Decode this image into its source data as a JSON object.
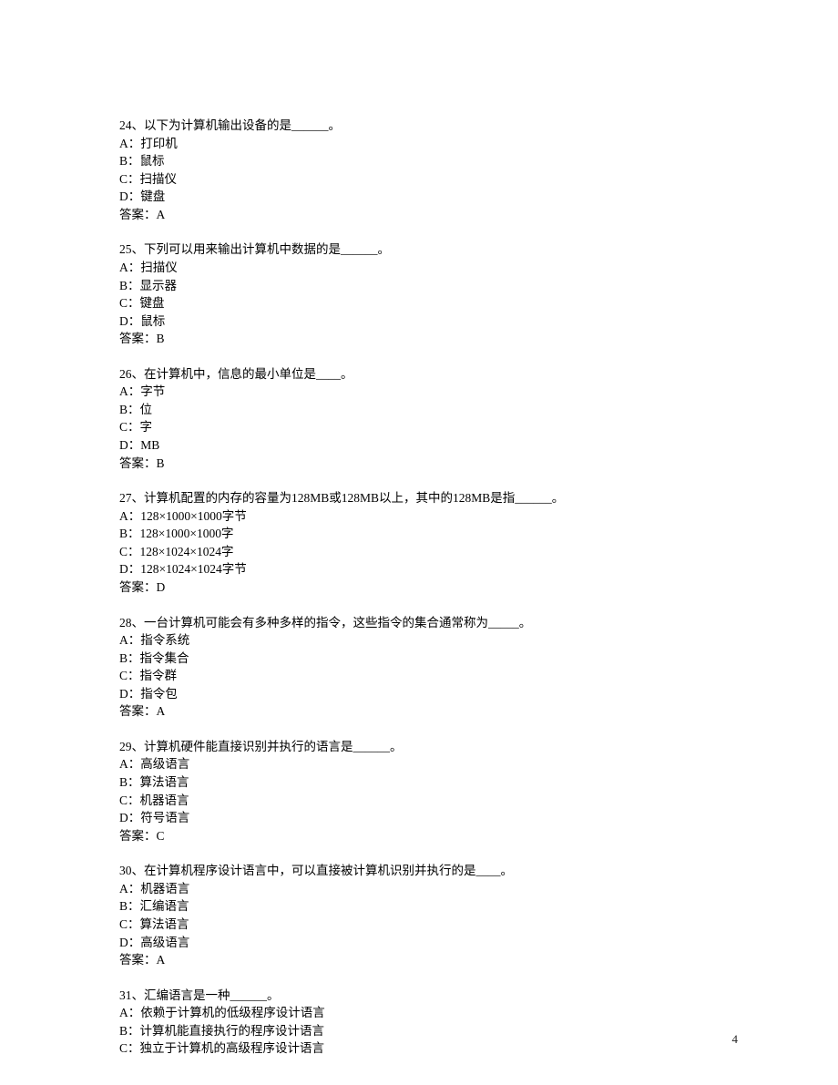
{
  "page_number": "4",
  "questions": [
    {
      "stem": "24、以下为计算机输出设备的是______。",
      "options": [
        "A：打印机",
        "B：鼠标",
        "C：扫描仪",
        "D：键盘"
      ],
      "answer": "答案：A"
    },
    {
      "stem": "25、下列可以用来输出计算机中数据的是______。",
      "options": [
        "A：扫描仪",
        "B：显示器",
        "C：键盘",
        "D：鼠标"
      ],
      "answer": "答案：B"
    },
    {
      "stem": "26、在计算机中，信息的最小单位是____。",
      "options": [
        "A：字节",
        "B：位",
        "C：字",
        "D：MB"
      ],
      "answer": "答案：B"
    },
    {
      "stem": "27、计算机配置的内存的容量为128MB或128MB以上，其中的128MB是指______。",
      "options": [
        "A：128×1000×1000字节",
        "B：128×1000×1000字",
        "C：128×1024×1024字",
        "D：128×1024×1024字节"
      ],
      "answer": "答案：D"
    },
    {
      "stem": "28、一台计算机可能会有多种多样的指令，这些指令的集合通常称为_____。",
      "options": [
        "A：指令系统",
        "B：指令集合",
        "C：指令群",
        "D：指令包"
      ],
      "answer": "答案：A"
    },
    {
      "stem": "29、计算机硬件能直接识别并执行的语言是______。",
      "options": [
        "A：高级语言",
        "B：算法语言",
        "C：机器语言",
        "D：符号语言"
      ],
      "answer": "答案：C"
    },
    {
      "stem": "30、在计算机程序设计语言中，可以直接被计算机识别并执行的是____。",
      "options": [
        "A：机器语言",
        "B：汇编语言",
        "C：算法语言",
        "D：高级语言"
      ],
      "answer": "答案：A",
      "extra_gap": true
    },
    {
      "stem": "31、汇编语言是一种______。",
      "options": [
        "A：依赖于计算机的低级程序设计语言",
        "B：计算机能直接执行的程序设计语言",
        "C：独立于计算机的高级程序设计语言"
      ],
      "answer": null
    }
  ]
}
